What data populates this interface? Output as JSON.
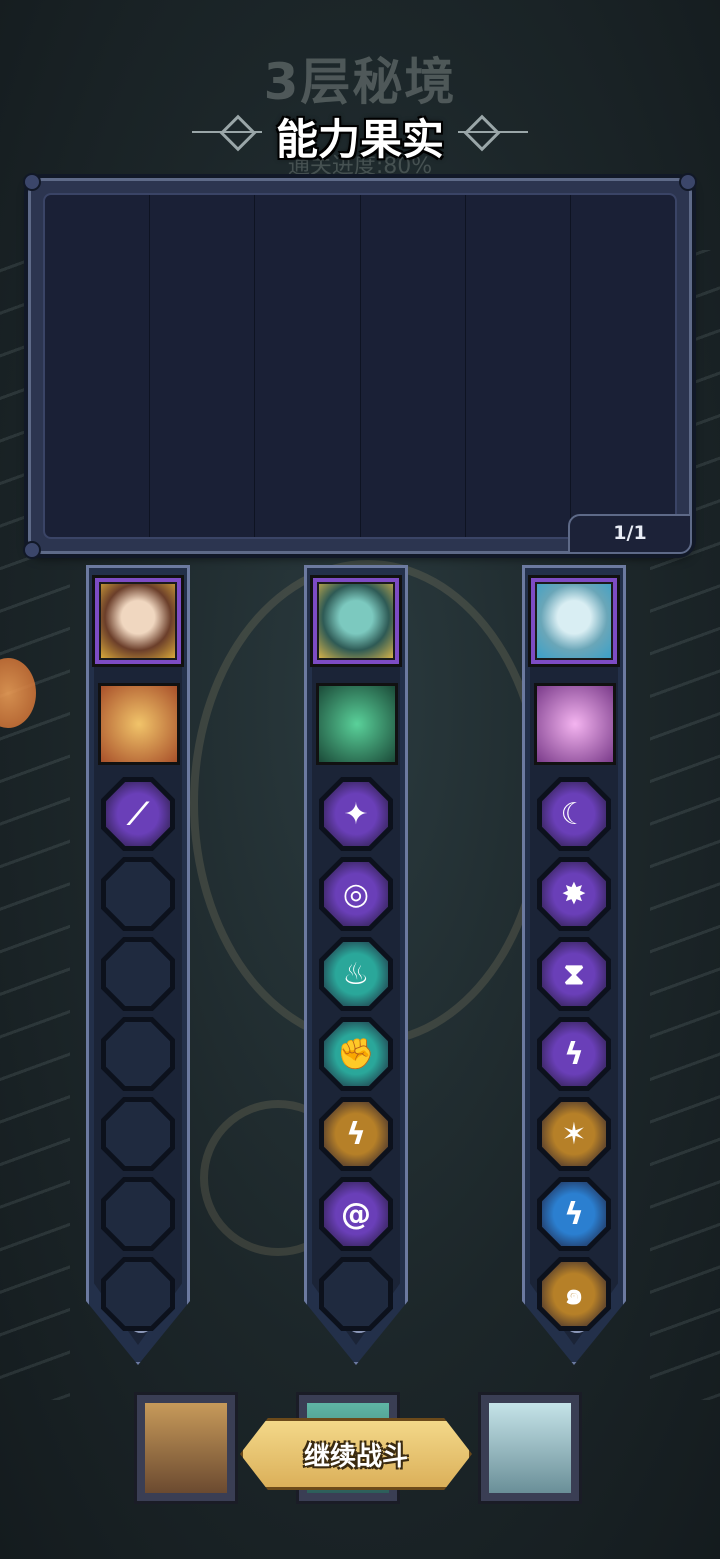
{
  "header": {
    "floor_title": "3层秘境",
    "main_title": "能力果实",
    "progress_text": "通关进度:80%"
  },
  "panel": {
    "page_indicator": "1/1"
  },
  "heroes": [
    {
      "name_icon": "golden-laurel-hero-portrait",
      "ability_icon": "golden-lion-ability-icon",
      "slots": [
        {
          "state": "filled",
          "icon": "purple-slash-icon",
          "color": "#6a3fb8"
        },
        {
          "state": "empty"
        },
        {
          "state": "empty"
        },
        {
          "state": "empty"
        },
        {
          "state": "empty"
        },
        {
          "state": "empty"
        },
        {
          "state": "empty"
        }
      ]
    },
    {
      "name_icon": "teal-elf-hero-portrait",
      "ability_icon": "green-serpent-ability-icon",
      "slots": [
        {
          "state": "filled",
          "icon": "purple-shatter-icon",
          "color": "#6a3fb8"
        },
        {
          "state": "filled",
          "icon": "purple-target-icon",
          "color": "#6a3fb8"
        },
        {
          "state": "filled",
          "icon": "teal-flame-icon",
          "color": "#2aa79a"
        },
        {
          "state": "filled",
          "icon": "teal-fist-icon",
          "color": "#2aa79a"
        },
        {
          "state": "filled",
          "icon": "gold-lightning-icon",
          "color": "#b68028"
        },
        {
          "state": "filled",
          "icon": "purple-vortex-icon",
          "color": "#6a3fb8"
        },
        {
          "state": "empty"
        }
      ]
    },
    {
      "name_icon": "ice-spirit-hero-portrait",
      "ability_icon": "pink-cone-ability-icon",
      "slots": [
        {
          "state": "filled",
          "icon": "purple-crescent-icon",
          "color": "#6a3fb8"
        },
        {
          "state": "filled",
          "icon": "purple-burst-icon",
          "color": "#6a3fb8"
        },
        {
          "state": "filled",
          "icon": "purple-hourglass-icon",
          "color": "#6a3fb8"
        },
        {
          "state": "filled",
          "icon": "purple-spark-icon",
          "color": "#6a3fb8"
        },
        {
          "state": "filled",
          "icon": "gold-crack-icon",
          "color": "#b68028"
        },
        {
          "state": "filled",
          "icon": "blue-thunder-icon",
          "color": "#2b7fd0"
        },
        {
          "state": "filled",
          "icon": "gold-swirl-icon",
          "color": "#b68028"
        }
      ]
    }
  ],
  "buttons": {
    "continue_label": "继续战斗"
  },
  "colors": {
    "rare_purple": "#7d4cc4",
    "panel_blue": "#2c3550",
    "button_gold": "#e7c36e"
  }
}
